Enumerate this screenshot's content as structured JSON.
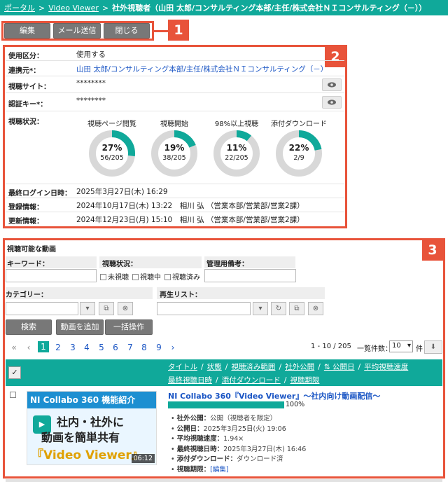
{
  "breadcrumb": {
    "portal": "ポータル",
    "video_viewer": "Video Viewer",
    "current": "社外視聴者（山田 太郎/コンサルティング本部/主任/株式会社ＮＩコンサルティング（－））"
  },
  "toolbar": {
    "edit": "編集",
    "mail": "メール送信",
    "close": "閉じる"
  },
  "callouts": [
    "1",
    "2",
    "3"
  ],
  "detail": {
    "usage_label": "使用区分：",
    "usage_value": "使用する",
    "contact_label": "連携元*：",
    "contact_value": "山田 太郎/コンサルティング本部/主任/株式会社ＮＩコンサルティング（－）",
    "site_label": "視聴サイト：",
    "site_value": "********",
    "key_label": "認証キー*：",
    "key_value": "********",
    "status_label": "視聴状況：",
    "gauges": [
      {
        "title": "視聴ページ閲覧",
        "percent": "27%",
        "count": "56/205",
        "ratio": 0.27
      },
      {
        "title": "視聴開始",
        "percent": "19%",
        "count": "38/205",
        "ratio": 0.19
      },
      {
        "title": "98%以上視聴",
        "percent": "11%",
        "count": "22/205",
        "ratio": 0.11
      },
      {
        "title": "添付ダウンロード",
        "percent": "22%",
        "count": "2/9",
        "ratio": 0.22
      }
    ],
    "last_login_label": "最終ログイン日時：",
    "last_login_value": "2025年3月27日(木) 16:29",
    "registered_label": "登録情報：",
    "registered_value": "2024年10月17日(木) 13:22　相川 弘 （営業本部/営業部/営業2課）",
    "updated_label": "更新情報：",
    "updated_value": "2024年12月23日(月) 15:10　相川 弘 （営業本部/営業部/営業2課）"
  },
  "videos": {
    "section_title": "視聴可能な動画",
    "keyword_label": "キーワード：",
    "status_label": "視聴状況：",
    "status_options": [
      "未視聴",
      "視聴中",
      "視聴済み"
    ],
    "memo_label": "管理用備考：",
    "category_label": "カテゴリー：",
    "playlist_label": "再生リスト：",
    "search_btn": "検索",
    "add_btn": "動画を追加",
    "bulk_btn": "一括操作",
    "pages": [
      "«",
      "‹",
      "1",
      "2",
      "3",
      "4",
      "5",
      "6",
      "7",
      "8",
      "9",
      "›"
    ],
    "range": "1 - 10 / 205",
    "per_page_label": "一覧件数：",
    "per_page": "10",
    "per_page_unit": "件",
    "columns_row1": [
      "タイトル",
      "状態",
      "視聴済み範囲",
      "社外公開",
      "⇅ 公開日",
      "平均視聴速度"
    ],
    "columns_row2": [
      "最終視聴日時",
      "添付ダウンロード",
      "視聴期限"
    ],
    "item": {
      "title": "NI Collabo 360『Video Viewer』～社内向け動画配信～",
      "progress": "100%",
      "progress_ratio": 1.0,
      "thumb_line1": "NI Collabo 360 機能紹介",
      "thumb_line2": "社内・社外に",
      "thumb_line3": "動画を簡単共有",
      "thumb_line4": "『Video Viewer』",
      "duration": "06:12",
      "meta": [
        {
          "k": "社外公開：",
          "v": "公開（視聴者を限定）"
        },
        {
          "k": "公開日：",
          "v": "2025年3月25日(火) 19:06"
        },
        {
          "k": "平均視聴速度：",
          "v": "1.94×"
        },
        {
          "k": "最終視聴日時：",
          "v": "2025年3月27日(木) 16:46"
        },
        {
          "k": "添付ダウンロード：",
          "v": "ダウンロード済"
        },
        {
          "k": "視聴期限：",
          "v": "[編集]"
        }
      ]
    }
  },
  "colors": {
    "accent": "#10a99a",
    "callout": "#e8533a",
    "link": "#1a55c4"
  }
}
